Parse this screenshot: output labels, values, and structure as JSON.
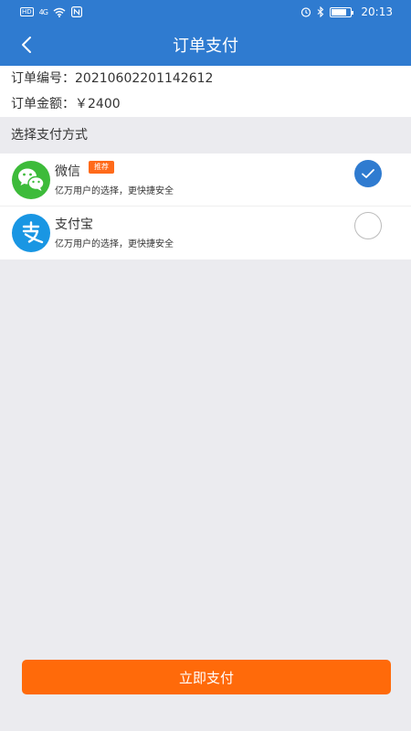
{
  "status_bar": {
    "hd": "HD",
    "signal": "4G",
    "time": "20:13"
  },
  "nav": {
    "title": "订单支付"
  },
  "order": {
    "number_label": "订单编号：",
    "number_value": "20210602201142612",
    "amount_label": "订单金额：",
    "amount_value": "￥2400"
  },
  "section": {
    "title": "选择支付方式"
  },
  "payments": [
    {
      "name": "微信",
      "badge": "推荐",
      "desc": "亿万用户的选择，更快捷安全",
      "icon": "wechat-icon",
      "selected": true
    },
    {
      "name": "支付宝",
      "desc": "亿万用户的选择，更快捷安全",
      "icon": "alipay-icon",
      "selected": false
    }
  ],
  "button": {
    "pay_label": "立即支付"
  },
  "colors": {
    "primary": "#2f7bd0",
    "accent": "#ff6a0a",
    "wechat": "#3dbb3a",
    "alipay": "#1996e3"
  }
}
